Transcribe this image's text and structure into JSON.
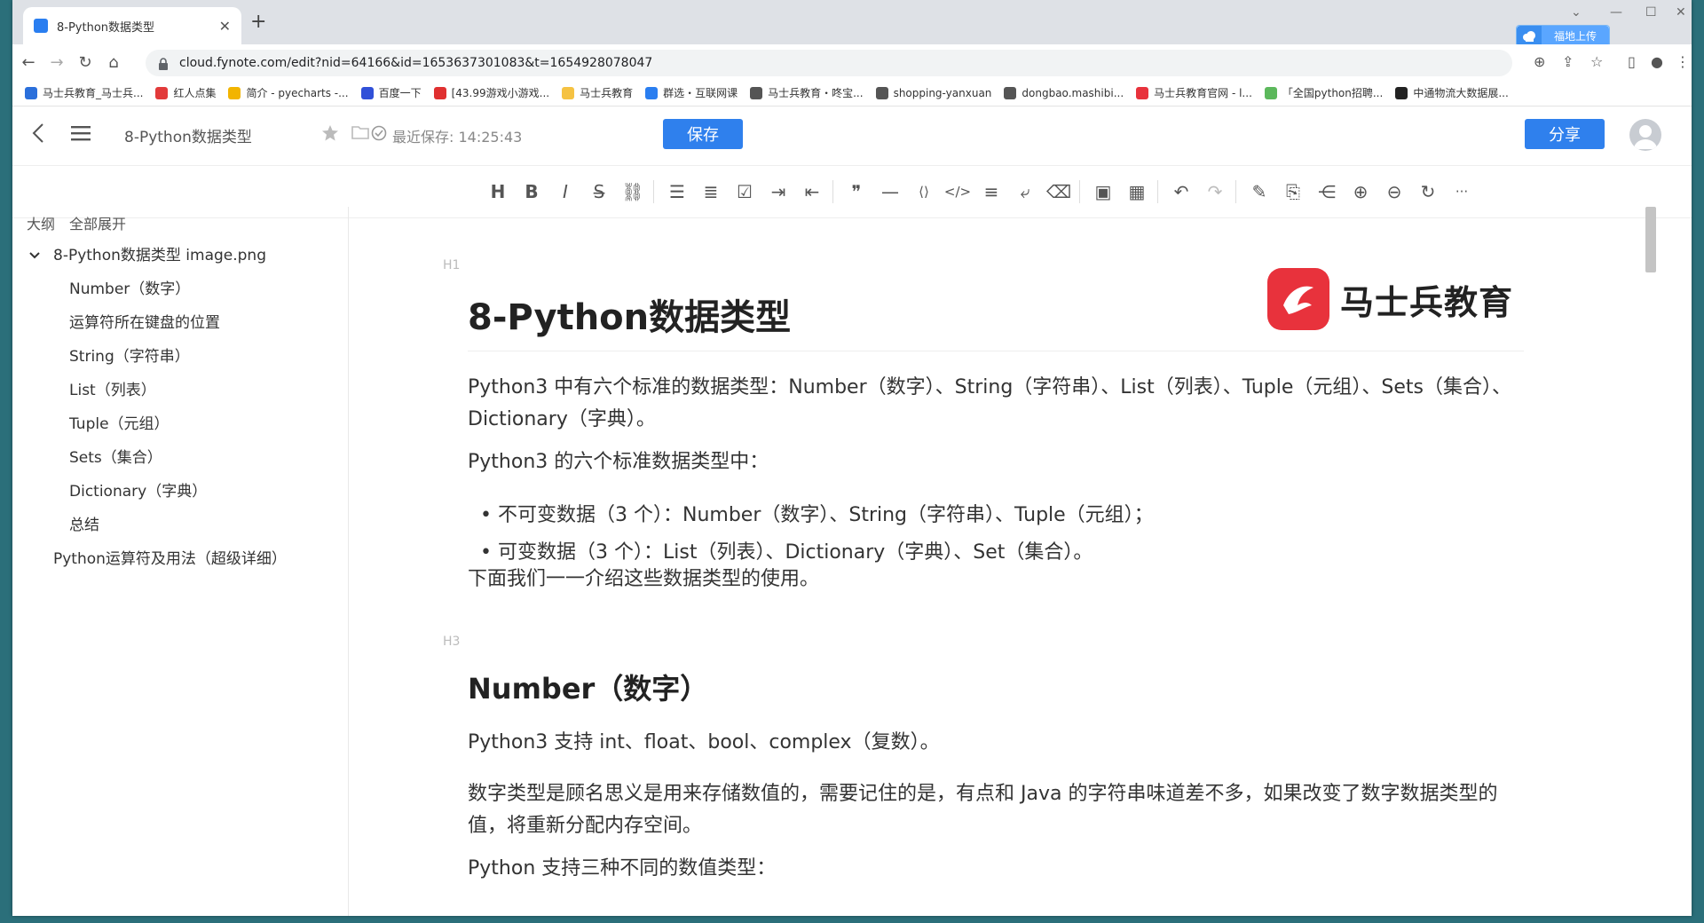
{
  "browser": {
    "tab_title": "8-Python数据类型",
    "url": "cloud.fynote.com/edit?nid=64166&id=1653637301083&t=1654928078047",
    "upload_button": "福地上传",
    "bookmarks": [
      {
        "label": "马士兵教育_马士兵...",
        "color": "#2a6fdb"
      },
      {
        "label": "红人点集",
        "color": "#e23a3a"
      },
      {
        "label": "简介 - pyecharts -...",
        "color": "#f2b400"
      },
      {
        "label": "百度一下",
        "color": "#3050d8"
      },
      {
        "label": "[43.99游戏小游戏...",
        "color": "#e03030"
      },
      {
        "label": "马士兵教育",
        "color": "#f5c242"
      },
      {
        "label": "群选・互联网课",
        "color": "#2a7ef0"
      },
      {
        "label": "马士兵教育・咚宝...",
        "color": "#555555"
      },
      {
        "label": "shopping-yanxuan",
        "color": "#555555"
      },
      {
        "label": "dongbao.mashibi...",
        "color": "#555555"
      },
      {
        "label": "马士兵教育官网 - l...",
        "color": "#e8323c"
      },
      {
        "label": "「全国python招聘...",
        "color": "#5cb85c"
      },
      {
        "label": "中通物流大数据展...",
        "color": "#222222"
      }
    ]
  },
  "app": {
    "doc_title": "8-Python数据类型",
    "save_status": "最近保存: 14:25:43",
    "save_button": "保存",
    "share_button": "分享"
  },
  "toolbar": [
    "heading-icon",
    "bold-icon",
    "italic-icon",
    "strikethrough-icon",
    "link-icon",
    "bullet-list-icon",
    "ordered-list-icon",
    "checklist-icon",
    "indent-icon",
    "outdent-icon",
    "quote-icon",
    "horizontal-rule-icon",
    "inline-code-icon",
    "code-block-icon",
    "align-icon",
    "text-wrap-icon",
    "clear-format-icon",
    "image-icon",
    "table-icon",
    "undo-icon",
    "redo-icon",
    "edit-icon",
    "export-icon",
    "share-node-icon",
    "zoom-in-icon",
    "zoom-out-icon",
    "refresh-icon",
    "more-icon"
  ],
  "sidebar": {
    "tab_outline": "大纲",
    "tab_expand_all": "全部展开",
    "items": [
      {
        "label": "8-Python数据类型 image.png",
        "level": 0
      },
      {
        "label": "Number（数字）",
        "level": 1
      },
      {
        "label": "运算符所在键盘的位置",
        "level": 1
      },
      {
        "label": "String（字符串）",
        "level": 1
      },
      {
        "label": "List（列表）",
        "level": 1
      },
      {
        "label": "Tuple（元组）",
        "level": 1
      },
      {
        "label": "Sets（集合）",
        "level": 1
      },
      {
        "label": "Dictionary（字典）",
        "level": 1
      },
      {
        "label": "总结",
        "level": 1
      },
      {
        "label": "Python运算符及用法（超级详细）",
        "level": 0
      }
    ]
  },
  "doc": {
    "h1_marker": "H1",
    "h1": "8-Python数据类型",
    "logo_text": "马士兵教育",
    "p1": "Python3 中有六个标准的数据类型：Number（数字）、String（字符串）、List（列表）、Tuple（元组）、Sets（集合）、Dictionary（字典）。",
    "p2": "Python3 的六个标准数据类型中：",
    "bullets": [
      "不可变数据（3 个）：Number（数字）、String（字符串）、Tuple（元组）；",
      "可变数据（3 个）：List（列表）、Dictionary（字典）、Set（集合）。"
    ],
    "p3": "下面我们一一介绍这些数据类型的使用。",
    "h3_marker": "H3",
    "h3": "Number（数字）",
    "p4": "Python3 支持 int、float、bool、complex（复数）。",
    "p5": "数字类型是顾名思义是用来存储数值的，需要记住的是，有点和 Java 的字符串味道差不多，如果改变了数字数据类型的值，将重新分配内存空间。",
    "p6": "Python 支持三种不同的数值类型："
  }
}
